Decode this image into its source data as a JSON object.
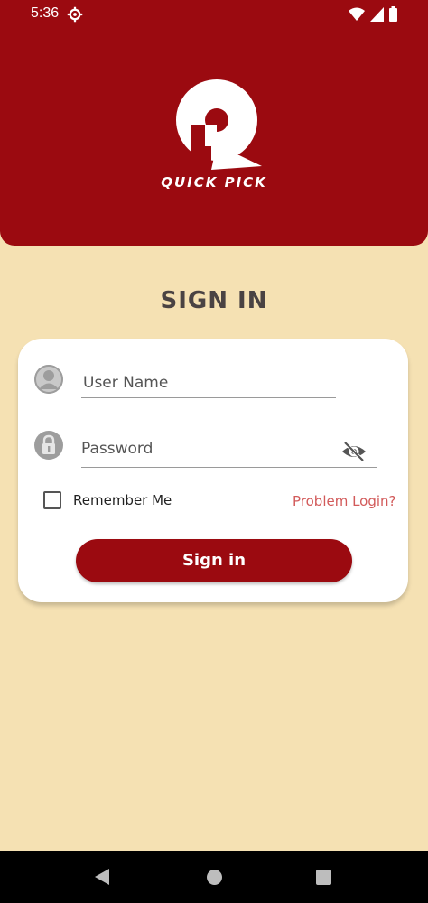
{
  "status_bar": {
    "time": "5:36",
    "icons": [
      "gear-icon",
      "wifi-icon",
      "signal-icon",
      "battery-icon"
    ]
  },
  "brand": {
    "name": "QUICK PICK",
    "logo_icon": "qp-logo-icon"
  },
  "page_title": "SIGN IN",
  "form": {
    "username_placeholder": "User Name",
    "password_placeholder": "Password",
    "remember_label": "Remember Me",
    "remember_checked": false,
    "problem_link": "Problem Login?",
    "signin_button": "Sign in"
  },
  "colors": {
    "header": "#9b0a10",
    "background": "#f5e1b3",
    "button": "#9b0a10",
    "link": "#d25a5a"
  },
  "nav_bar": {
    "icons": [
      "back-icon",
      "home-icon",
      "recents-icon"
    ]
  }
}
